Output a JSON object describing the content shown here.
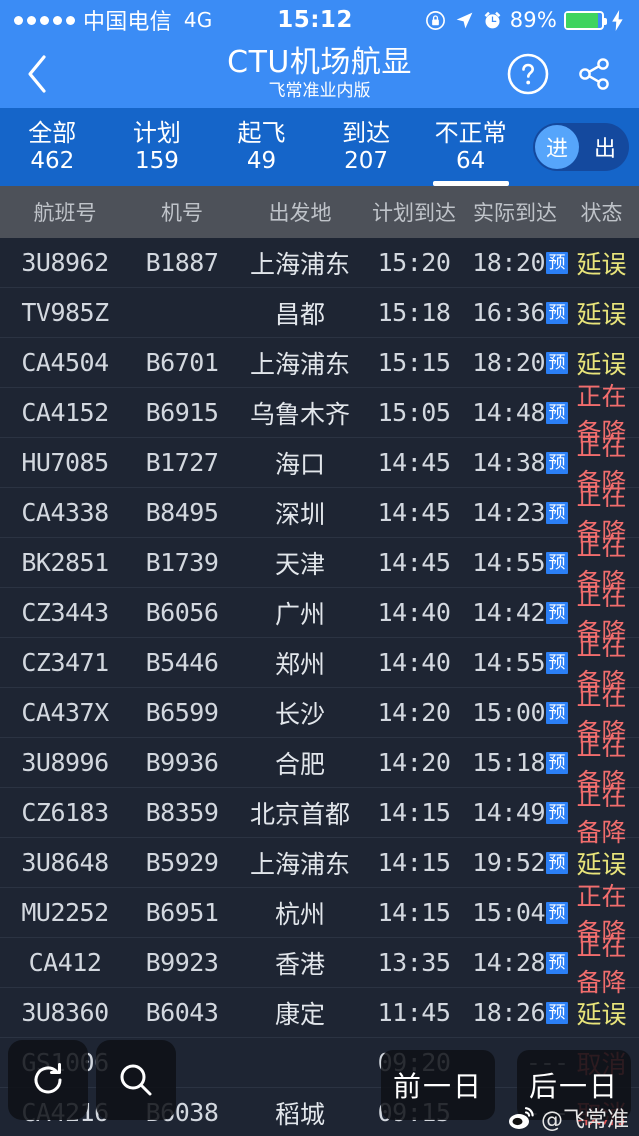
{
  "status_bar": {
    "carrier": "中国电信",
    "network": "4G",
    "time": "15:12",
    "battery_pct": "89%",
    "battery_level": 89,
    "icons": [
      "signal-dots",
      "rotation-lock-icon",
      "location-arrow-icon",
      "alarm-clock-icon",
      "battery-icon",
      "charging-bolt-icon"
    ]
  },
  "nav": {
    "back_icon": "chevron-left-icon",
    "title": "CTU机场航显",
    "subtitle": "飞常准业内版",
    "help_icon": "question-mark-icon",
    "share_icon": "share-icon"
  },
  "tabs": [
    {
      "label": "全部",
      "count": "462",
      "active": false
    },
    {
      "label": "计划",
      "count": "159",
      "active": false
    },
    {
      "label": "起飞",
      "count": "49",
      "active": false
    },
    {
      "label": "到达",
      "count": "207",
      "active": false
    },
    {
      "label": "不正常",
      "count": "64",
      "active": true
    }
  ],
  "direction_toggle": {
    "in_label": "进",
    "out_label": "出",
    "selected": "进"
  },
  "columns": [
    "航班号",
    "机号",
    "出发地",
    "计划到达",
    "实际到达",
    "状态"
  ],
  "badge_label": "预",
  "colors": {
    "brand_blue": "#3b8cf5",
    "tab_blue": "#1565c9",
    "table_bg": "#1e2533",
    "delay_yellow": "#e8e47a",
    "divert_red": "#f26d6d",
    "cancel_red": "#e05a5a",
    "badge_blue": "#2b7ff5"
  },
  "rows": [
    {
      "flight": "3U8962",
      "reg": "B1887",
      "from": "上海浦东",
      "plan": "15:20",
      "actual": "18:20",
      "badge": true,
      "status": "延误",
      "status_type": "delay"
    },
    {
      "flight": "TV985Z",
      "reg": "",
      "from": "昌都",
      "plan": "15:18",
      "actual": "16:36",
      "badge": true,
      "status": "延误",
      "status_type": "delay"
    },
    {
      "flight": "CA4504",
      "reg": "B6701",
      "from": "上海浦东",
      "plan": "15:15",
      "actual": "18:20",
      "badge": true,
      "status": "延误",
      "status_type": "delay"
    },
    {
      "flight": "CA4152",
      "reg": "B6915",
      "from": "乌鲁木齐",
      "plan": "15:05",
      "actual": "14:48",
      "badge": true,
      "status": "正在备降",
      "status_type": "divert"
    },
    {
      "flight": "HU7085",
      "reg": "B1727",
      "from": "海口",
      "plan": "14:45",
      "actual": "14:38",
      "badge": true,
      "status": "正在备降",
      "status_type": "divert"
    },
    {
      "flight": "CA4338",
      "reg": "B8495",
      "from": "深圳",
      "plan": "14:45",
      "actual": "14:23",
      "badge": true,
      "status": "正在备降",
      "status_type": "divert"
    },
    {
      "flight": "BK2851",
      "reg": "B1739",
      "from": "天津",
      "plan": "14:45",
      "actual": "14:55",
      "badge": true,
      "status": "正在备降",
      "status_type": "divert"
    },
    {
      "flight": "CZ3443",
      "reg": "B6056",
      "from": "广州",
      "plan": "14:40",
      "actual": "14:42",
      "badge": true,
      "status": "正在备降",
      "status_type": "divert"
    },
    {
      "flight": "CZ3471",
      "reg": "B5446",
      "from": "郑州",
      "plan": "14:40",
      "actual": "14:55",
      "badge": true,
      "status": "正在备降",
      "status_type": "divert"
    },
    {
      "flight": "CA437X",
      "reg": "B6599",
      "from": "长沙",
      "plan": "14:20",
      "actual": "15:00",
      "badge": true,
      "status": "正在备降",
      "status_type": "divert"
    },
    {
      "flight": "3U8996",
      "reg": "B9936",
      "from": "合肥",
      "plan": "14:20",
      "actual": "15:18",
      "badge": true,
      "status": "正在备降",
      "status_type": "divert"
    },
    {
      "flight": "CZ6183",
      "reg": "B8359",
      "from": "北京首都",
      "plan": "14:15",
      "actual": "14:49",
      "badge": true,
      "status": "正在备降",
      "status_type": "divert"
    },
    {
      "flight": "3U8648",
      "reg": "B5929",
      "from": "上海浦东",
      "plan": "14:15",
      "actual": "19:52",
      "badge": true,
      "status": "延误",
      "status_type": "delay"
    },
    {
      "flight": "MU2252",
      "reg": "B6951",
      "from": "杭州",
      "plan": "14:15",
      "actual": "15:04",
      "badge": true,
      "status": "正在备降",
      "status_type": "divert"
    },
    {
      "flight": "CA412",
      "reg": "B9923",
      "from": "香港",
      "plan": "13:35",
      "actual": "14:28",
      "badge": true,
      "status": "正在备降",
      "status_type": "divert"
    },
    {
      "flight": "3U8360",
      "reg": "B6043",
      "from": "康定",
      "plan": "11:45",
      "actual": "18:26",
      "badge": true,
      "status": "延误",
      "status_type": "delay"
    },
    {
      "flight": "GS1006",
      "reg": "",
      "from": "",
      "plan": "09:20",
      "actual": "---",
      "badge": false,
      "status": "取消",
      "status_type": "cancel"
    },
    {
      "flight": "CA4216",
      "reg": "B6038",
      "from": "稻城",
      "plan": "09:15",
      "actual": "---",
      "badge": false,
      "status": "取消",
      "status_type": "cancel"
    }
  ],
  "fabs": {
    "refresh_icon": "refresh-icon",
    "search_icon": "search-icon",
    "prev_day": "前一日",
    "next_day": "后一日"
  },
  "watermark": {
    "logo": "weibo-icon",
    "handle": "@飞常准"
  }
}
